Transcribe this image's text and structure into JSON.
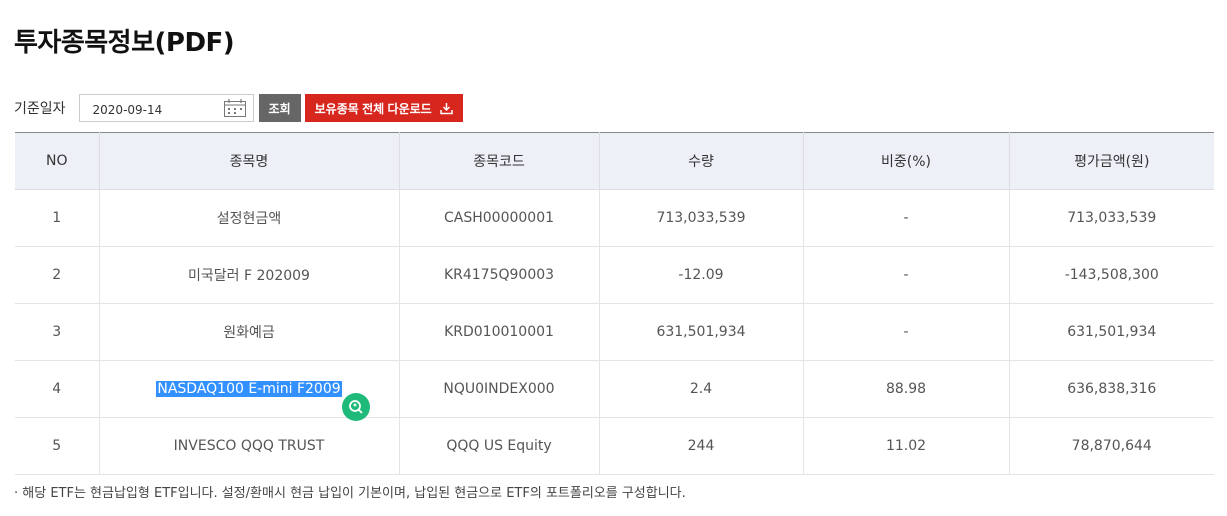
{
  "page": {
    "title": "투자종목정보(PDF)"
  },
  "controls": {
    "date_label": "기준일자",
    "date_value": "2020-09-14",
    "search_button": "조회",
    "download_button": "보유종목 전체 다운로드"
  },
  "table": {
    "headers": [
      "NO",
      "종목명",
      "종목코드",
      "수량",
      "비중(%)",
      "평가금액(원)"
    ],
    "rows": [
      {
        "no": "1",
        "name": "설정현금액",
        "code": "CASH00000001",
        "qty": "713,033,539",
        "weight": "-",
        "value": "713,033,539"
      },
      {
        "no": "2",
        "name": "미국달러 F 202009",
        "code": "KR4175Q90003",
        "qty": "-12.09",
        "weight": "-",
        "value": "-143,508,300"
      },
      {
        "no": "3",
        "name": "원화예금",
        "code": "KRD010010001",
        "qty": "631,501,934",
        "weight": "-",
        "value": "631,501,934"
      },
      {
        "no": "4",
        "name": "NASDAQ100 E-mini F2009",
        "code": "NQU0INDEX000",
        "qty": "2.4",
        "weight": "88.98",
        "value": "636,838,316"
      },
      {
        "no": "5",
        "name": "INVESCO QQQ TRUST",
        "code": "QQQ US Equity",
        "qty": "244",
        "weight": "11.02",
        "value": "78,870,644"
      }
    ]
  },
  "footnote": "· 해당 ETF는 현금납입형 ETF입니다. 설정/환매시 현금 납입이 기본이며, 납입된 현금으로 ETF의 포트폴리오를 구성합니다.",
  "icons": {
    "calendar": "calendar-icon",
    "download": "download-icon",
    "selection_helper": "search-translate-icon"
  },
  "colors": {
    "download_button": "#d7261e",
    "search_button": "#666666",
    "header_bg": "#eef0f7",
    "selection": "#3390ff",
    "helper_icon": "#1fb97a"
  }
}
